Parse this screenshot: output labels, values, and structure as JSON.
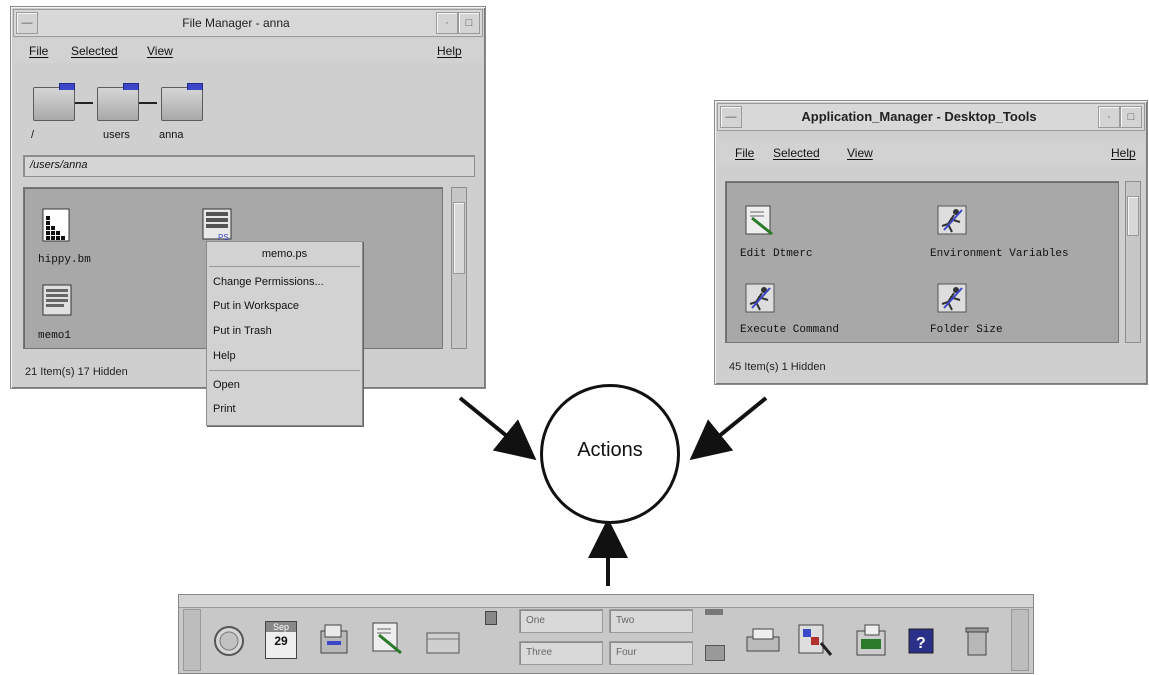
{
  "file_manager": {
    "title": "File Manager - anna",
    "menus": [
      "File",
      "Selected",
      "View",
      "Help"
    ],
    "path_labels": [
      "/",
      "users",
      "anna"
    ],
    "path_field": "/users/anna",
    "items": [
      "hippy.bm",
      "memo.ps",
      "memo1"
    ],
    "status": "21 Item(s) 17 Hidden"
  },
  "context_menu": {
    "header": "memo.ps",
    "items": [
      "Change Permissions...",
      "Put in Workspace",
      "Put in Trash",
      "Help",
      "Open",
      "Print"
    ]
  },
  "app_manager": {
    "title": "Application_Manager - Desktop_Tools",
    "menus": [
      "File",
      "Selected",
      "View",
      "Help"
    ],
    "items": [
      "Edit Dtmerc",
      "Environment Variables",
      "Execute Command",
      "Folder Size"
    ],
    "status": "45 Item(s) 1 Hidden"
  },
  "center": {
    "label": "Actions"
  },
  "front_panel": {
    "calendar_month": "Sep",
    "calendar_day": "29",
    "workspaces": [
      "One",
      "Two",
      "Three",
      "Four"
    ]
  },
  "colors": {
    "window_bg": "#cfcfcf",
    "pane_bg": "#a8a8a8",
    "folder_accent": "#3c47c9"
  }
}
